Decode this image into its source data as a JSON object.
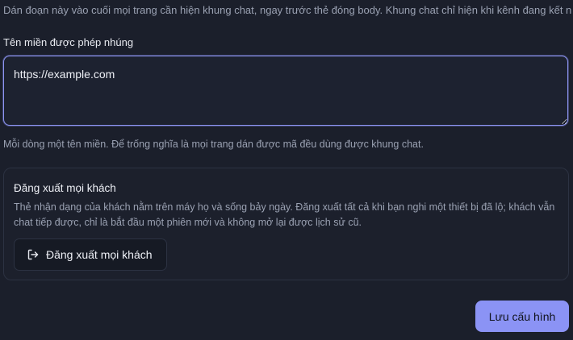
{
  "intro_text": "Dán đoạn này vào cuối mọi trang cần hiện khung chat, ngay trước thẻ đóng body. Khung chat chỉ hiện khi kênh đang kết nối.",
  "allowed_domains": {
    "label": "Tên miền được phép nhúng",
    "value": "https://example.com",
    "hint": "Mỗi dòng một tên miền. Để trống nghĩa là mọi trang dán được mã đều dùng được khung chat."
  },
  "signout_card": {
    "title": "Đăng xuất mọi khách",
    "description": "Thẻ nhận dạng của khách nằm trên máy họ và sống bảy ngày. Đăng xuất tất cả khi bạn nghi một thiết bị đã lộ; khách vẫn chat tiếp được, chỉ là bắt đầu một phiên mới và không mở lại được lịch sử cũ.",
    "button_label": "Đăng xuất mọi khách",
    "button_icon": "logout-icon"
  },
  "save_button_label": "Lưu cấu hình",
  "colors": {
    "accent": "#8b93f5",
    "background": "#1b1f2b"
  }
}
